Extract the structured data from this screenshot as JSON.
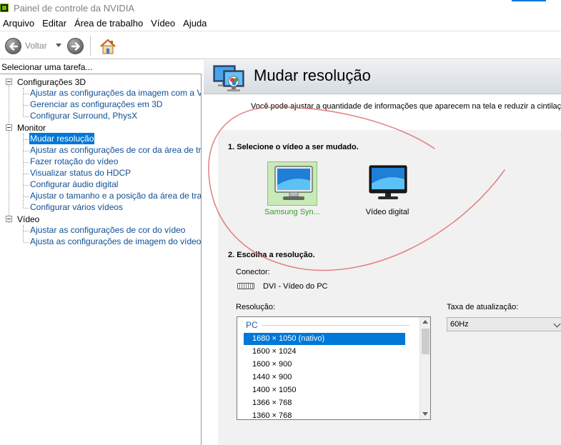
{
  "window": {
    "title": "Painel de controle da NVIDIA"
  },
  "menu": [
    "Arquivo",
    "Editar",
    "Área de trabalho",
    "Vídeo",
    "Ajuda"
  ],
  "toolbar": {
    "back_label": "Voltar"
  },
  "task_pane": {
    "header": "Selecionar uma tarefa...",
    "categories": [
      {
        "label": "Configurações 3D",
        "items": [
          "Ajustar as configurações da imagem com a Visuali:",
          "Gerenciar as configurações em 3D",
          "Configurar Surround, PhysX"
        ]
      },
      {
        "label": "Monitor",
        "items": [
          "Mudar resolução",
          "Ajustar as configurações de cor da área de trabal",
          "Fazer rotação do vídeo",
          "Visualizar status do HDCP",
          "Configurar áudio digital",
          "Ajustar o tamanho e a posição da área de trabalh",
          "Configurar vários vídeos"
        ]
      },
      {
        "label": "Vídeo",
        "items": [
          "Ajustar as configurações de cor do vídeo",
          "Ajusta as configurações de imagem do vídeo"
        ]
      }
    ],
    "selected_item": "Mudar resolução"
  },
  "page": {
    "title": "Mudar resolução",
    "intro": "Você pode ajustar a quantidade de informações que aparecem na tela e reduzir  a cintilação",
    "step1": {
      "title": "1. Selecione o vídeo a ser mudado.",
      "displays": [
        {
          "label": "Samsung Syn...",
          "selected": true
        },
        {
          "label": "Vídeo digital",
          "selected": false
        }
      ]
    },
    "step2": {
      "title": "2. Escolha a resolução.",
      "connector_label": "Conector:",
      "connector_value": "DVI - Vídeo do PC",
      "resolution_label": "Resolução:",
      "group": "PC",
      "resolutions": [
        "1680 × 1050 (nativo)",
        "1600 × 1024",
        "1600 × 900",
        "1440 × 900",
        "1400 × 1050",
        "1366 × 768",
        "1360 × 768"
      ],
      "selected_resolution": "1680 × 1050 (nativo)",
      "refresh_label": "Taxa de atualização:",
      "refresh_value": "60Hz"
    }
  },
  "colors": {
    "selection": "#0078d7",
    "link": "#0f4f92",
    "nvidia_green": "#76b900",
    "annotation": "#e07070"
  }
}
